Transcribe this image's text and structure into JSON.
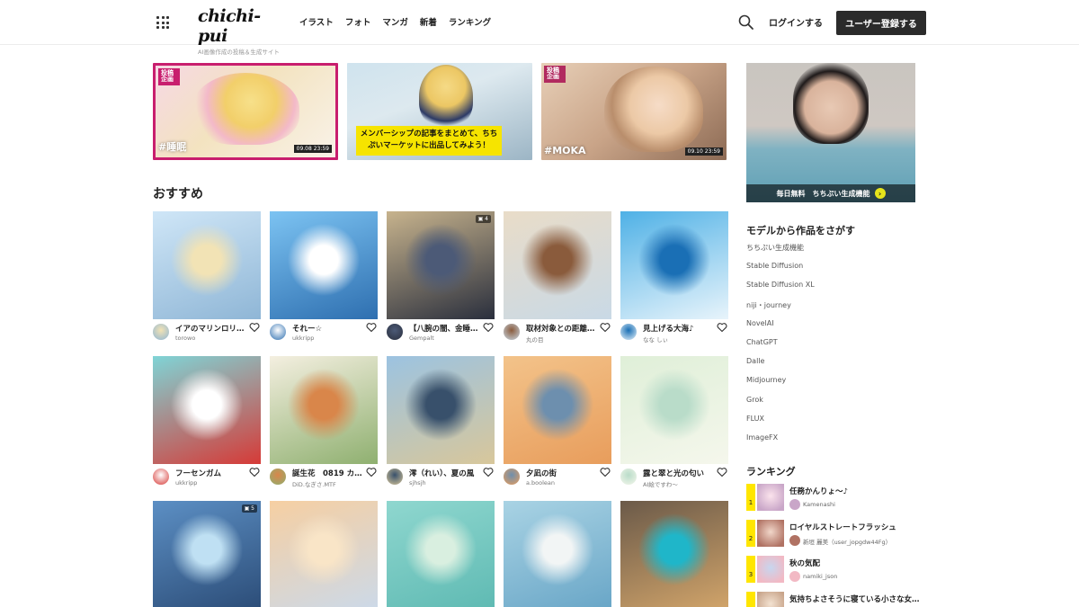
{
  "header": {
    "logo": "chichi-pui",
    "logo_sub": "AI画像作成の投稿＆生成サイト",
    "nav": [
      "イラスト",
      "フォト",
      "マンガ",
      "新着",
      "ランキング"
    ],
    "login": "ログインする",
    "register": "ユーザー登録する"
  },
  "banners": [
    {
      "badge": "投稿企画",
      "tag": "#睡眠",
      "deadline": "09.08 23:59"
    },
    {
      "caption": "メンバーシップの記事をまとめて、ちちぷいマーケットに出品してみよう！"
    },
    {
      "badge": "投稿企画",
      "tag": "#MOKA",
      "deadline": "09.10 23:59"
    }
  ],
  "section_title": "おすすめ",
  "cards": [
    {
      "title": "イアのマリンロリ…",
      "user": "torowo",
      "count": ""
    },
    {
      "title": "それー☆",
      "user": "ukkripp",
      "count": ""
    },
    {
      "title": "【八腕の闇、金睡…",
      "user": "Gempalt",
      "count": "4"
    },
    {
      "title": "取材対象との距離…",
      "user": "丸の目",
      "count": ""
    },
    {
      "title": "見上げる大海♪",
      "user": "なな しぃ",
      "count": ""
    },
    {
      "title": "フーセンガム",
      "user": "ukkripp",
      "count": ""
    },
    {
      "title": "誕生花　0819 カ…",
      "user": "DiD.なぎさ.MTF",
      "count": ""
    },
    {
      "title": "澪（れい）、夏の風",
      "user": "sjhsjh",
      "count": ""
    },
    {
      "title": "夕凪の街",
      "user": "a.boolean",
      "count": ""
    },
    {
      "title": "露と翠と光の匂い",
      "user": "AI絵ですわ〜",
      "count": ""
    },
    {
      "title": "",
      "user": "",
      "count": "5"
    },
    {
      "title": "",
      "user": "",
      "count": ""
    },
    {
      "title": "",
      "user": "",
      "count": ""
    },
    {
      "title": "",
      "user": "",
      "count": ""
    },
    {
      "title": "",
      "user": "",
      "count": ""
    }
  ],
  "sidebar": {
    "ad_text": "毎日無料　ちちぷい生成機能",
    "models_heading": "モデルから作品をさがす",
    "models": [
      "ちちぷい生成機能",
      "Stable Diffusion",
      "Stable Diffusion XL",
      "niji・journey",
      "NovelAI",
      "ChatGPT",
      "Dalle",
      "Midjourney",
      "Grok",
      "FLUX",
      "ImageFX"
    ],
    "ranking_heading": "ランキング",
    "ranking": [
      {
        "num": "1",
        "title": "任務かんりょ〜♪",
        "user": "Kamenashi"
      },
      {
        "num": "2",
        "title": "ロイヤルストレートフラッシュ",
        "user": "新垣 麗美（user_jopgdw44Fg）"
      },
      {
        "num": "3",
        "title": "秋の気配",
        "user": "namiki_json"
      },
      {
        "num": "4",
        "title": "気持ちよさそうに寝ている小さな女…",
        "user": ""
      }
    ]
  },
  "colors": {
    "accent_pink": "#c81e6e",
    "rank_yellow": "#ffe600",
    "register_bg": "#2b2b2b",
    "caption_yellow": "#f6e400"
  }
}
